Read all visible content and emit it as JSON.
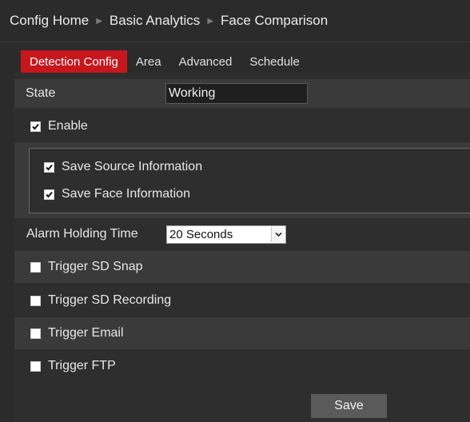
{
  "breadcrumb": {
    "items": [
      "Config Home",
      "Basic Analytics",
      "Face Comparison"
    ]
  },
  "tabs": [
    {
      "label": "Detection Config",
      "active": true
    },
    {
      "label": "Area",
      "active": false
    },
    {
      "label": "Advanced",
      "active": false
    },
    {
      "label": "Schedule",
      "active": false
    }
  ],
  "form": {
    "state_label": "State",
    "state_value": "Working",
    "enable_label": "Enable",
    "enable_checked": true,
    "save_source_label": "Save Source Information",
    "save_source_checked": true,
    "save_face_label": "Save Face Information",
    "save_face_checked": true,
    "alarm_holding_label": "Alarm Holding Time",
    "alarm_holding_value": "20 Seconds",
    "trigger_sd_snap_label": "Trigger SD Snap",
    "trigger_sd_snap_checked": false,
    "trigger_sd_recording_label": "Trigger SD Recording",
    "trigger_sd_recording_checked": false,
    "trigger_email_label": "Trigger Email",
    "trigger_email_checked": false,
    "trigger_ftp_label": "Trigger FTP",
    "trigger_ftp_checked": false
  },
  "actions": {
    "save_label": "Save"
  },
  "colors": {
    "accent": "#c8161d",
    "background": "#2b2b2b",
    "row_light": "#3a3a3a"
  }
}
